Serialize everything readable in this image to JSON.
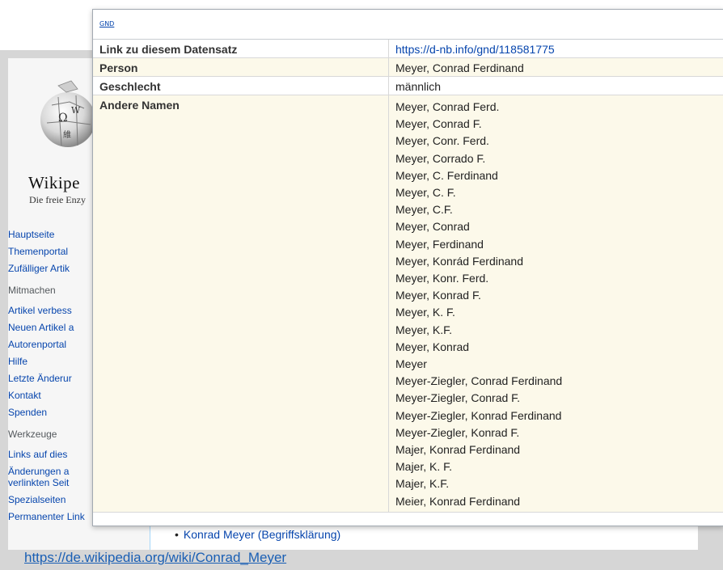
{
  "wiki": {
    "wordmark": "Wikipe",
    "tagline": "Die freie Enzy",
    "nav_main": [
      "Hauptseite",
      "Themenportal",
      "Zufälliger Artik"
    ],
    "heading_mitmachen": "Mitmachen",
    "nav_mitmachen": [
      "Artikel verbess",
      "Neuen Artikel a",
      "Autorenportal",
      "Hilfe",
      "Letzte Änderur",
      "Kontakt",
      "Spenden"
    ],
    "heading_werkzeuge": "Werkzeuge",
    "nav_werkzeuge": [
      "Links auf dies",
      "Änderungen a",
      "verlinkten Seit",
      "Spezialseiten",
      "Permanenter Link"
    ],
    "bullet_link": "Konrad Meyer (Begriffsklärung)",
    "url": "https://de.wikipedia.org/wiki/Conrad_Meyer"
  },
  "popup": {
    "tag": "GND",
    "rows": {
      "link_label": "Link zu diesem Datensatz",
      "link_value": "https://d-nb.info/gnd/118581775",
      "person_label": "Person",
      "person_value": "Meyer, Conrad Ferdinand",
      "gender_label": "Geschlecht",
      "gender_value": "männlich",
      "names_label": "Andere Namen"
    },
    "other_names": [
      "Meyer, Conrad Ferd.",
      "Meyer, Conrad F.",
      "Meyer, Conr. Ferd.",
      "Meyer, Corrado F.",
      "Meyer, C. Ferdinand",
      "Meyer, C. F.",
      "Meyer, C.F.",
      "Meyer, Conrad",
      "Meyer, Ferdinand",
      "Meyer, Konrád Ferdinand",
      "Meyer, Konr. Ferd.",
      "Meyer, Konrad F.",
      "Meyer, K. F.",
      "Meyer, K.F.",
      "Meyer, Konrad",
      "Meyer",
      "Meyer-Ziegler, Conrad Ferdinand",
      "Meyer-Ziegler, Conrad F.",
      "Meyer-Ziegler, Konrad Ferdinand",
      "Meyer-Ziegler, Konrad F.",
      "Majer, Konrad Ferdinand",
      "Majer, K. F.",
      "Majer, K.F.",
      "Meier, Konrad Ferdinand"
    ]
  }
}
